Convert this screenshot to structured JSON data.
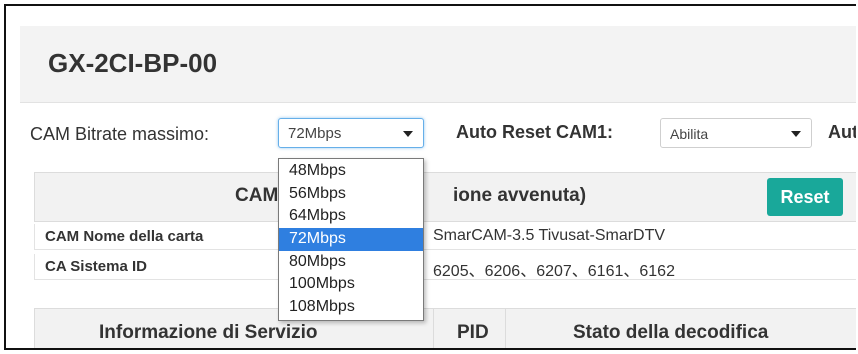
{
  "page": {
    "device_title": "GX-2CI-BP-00"
  },
  "controls": {
    "bitrate_label": "CAM Bitrate massimo:",
    "bitrate_value": "72Mbps",
    "auto_reset_label": "Auto Reset CAM1:",
    "auto_reset_value": "Abilita",
    "cut_label": "Aut"
  },
  "dropdown": {
    "options": [
      "48Mbps",
      "56Mbps",
      "64Mbps",
      "72Mbps",
      "80Mbps",
      "100Mbps",
      "108Mbps"
    ],
    "selected": "72Mbps"
  },
  "cam": {
    "title_visible": "CAM",
    "status_visible": "ione avvenuta)",
    "reset_label": "Reset",
    "rows": [
      {
        "key": "CAM Nome della carta",
        "value": "SmarCAM-3.5 Tivusat-SmarDTV"
      },
      {
        "key": "CA Sistema ID",
        "value": "6205、6206、6207、6161、6162"
      }
    ]
  },
  "table": {
    "headers": [
      "Informazione di Servizio",
      "PID",
      "Stato della decodifica"
    ]
  },
  "colors": {
    "accent_button": "#19a89a",
    "selected_option": "#2f7fe0",
    "focus_border": "#66afe9"
  }
}
